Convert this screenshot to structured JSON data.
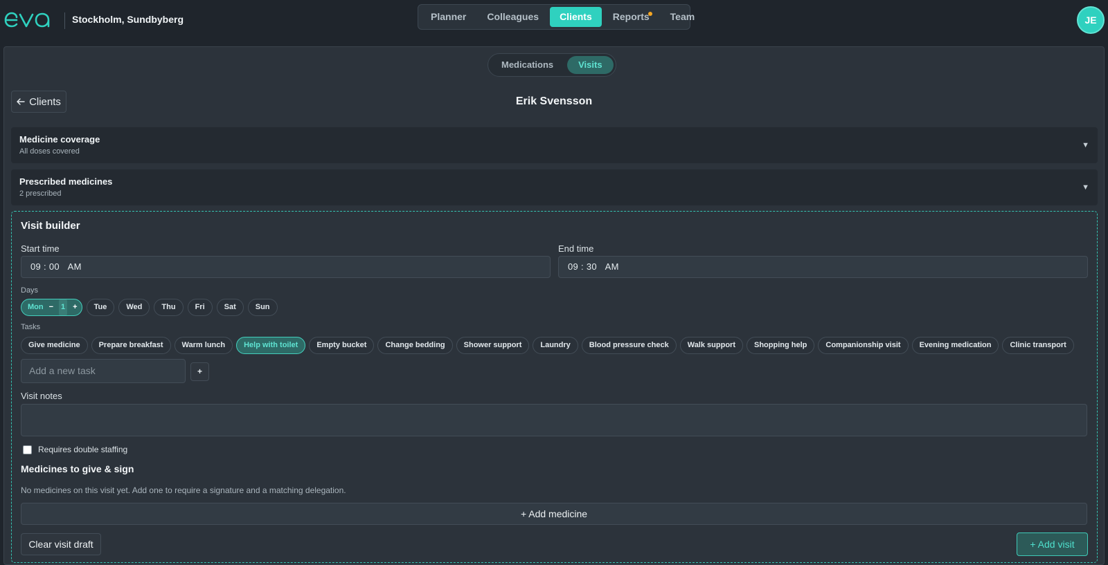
{
  "header": {
    "location": "Stockholm, Sundbyberg",
    "nav": [
      {
        "label": "Planner",
        "active": false
      },
      {
        "label": "Colleagues",
        "active": false
      },
      {
        "label": "Clients",
        "active": true
      },
      {
        "label": "Reports",
        "active": false,
        "notification": true
      },
      {
        "label": "Team",
        "active": false
      }
    ],
    "avatar_initials": "JE"
  },
  "tabs": [
    {
      "label": "Medications",
      "active": false
    },
    {
      "label": "Visits",
      "active": true
    }
  ],
  "back_button": {
    "icon": "arrow-left-icon",
    "label": "Clients"
  },
  "client_name": "Erik Svensson",
  "cards": [
    {
      "title": "Medicine coverage",
      "subtitle": "All doses covered",
      "icon": "caret-down-icon"
    },
    {
      "title": "Prescribed medicines",
      "subtitle": "2 prescribed",
      "icon": "caret-down-icon"
    }
  ],
  "builder": {
    "title": "Visit builder",
    "start_time_label": "Start time",
    "start_time": {
      "hour": "09",
      "minute": "00",
      "period": "AM"
    },
    "end_time_label": "End time",
    "end_time": {
      "hour": "09",
      "minute": "30",
      "period": "AM"
    },
    "days_label": "Days",
    "days": [
      {
        "label": "Mon",
        "active": true,
        "count": "1"
      },
      {
        "label": "Tue",
        "active": false
      },
      {
        "label": "Wed",
        "active": false
      },
      {
        "label": "Thu",
        "active": false
      },
      {
        "label": "Fri",
        "active": false
      },
      {
        "label": "Sat",
        "active": false
      },
      {
        "label": "Sun",
        "active": false
      }
    ],
    "tasks_label": "Tasks",
    "tasks": [
      {
        "label": "Give medicine",
        "active": false
      },
      {
        "label": "Prepare breakfast",
        "active": false
      },
      {
        "label": "Warm lunch",
        "active": false
      },
      {
        "label": "Help with toilet",
        "active": true
      },
      {
        "label": "Empty bucket",
        "active": false
      },
      {
        "label": "Change bedding",
        "active": false
      },
      {
        "label": "Shower support",
        "active": false
      },
      {
        "label": "Laundry",
        "active": false
      },
      {
        "label": "Blood pressure check",
        "active": false
      },
      {
        "label": "Walk support",
        "active": false
      },
      {
        "label": "Shopping help",
        "active": false
      },
      {
        "label": "Companionship visit",
        "active": false
      },
      {
        "label": "Evening medication",
        "active": false
      },
      {
        "label": "Clinic transport",
        "active": false
      }
    ],
    "new_task_placeholder": "Add a new task",
    "add_task_button": "+",
    "visit_notes_label": "Visit notes",
    "visit_notes_value": "",
    "double_staffing_label": "Requires double staffing",
    "double_staffing_checked": false,
    "medicines_title": "Medicines to give & sign",
    "medicines_empty": "No medicines on this visit yet. Add one to require a signature and a matching delegation.",
    "add_medicine_button": "+ Add medicine",
    "clear_button": "Clear visit draft",
    "add_visit_button": "+ Add visit"
  },
  "colors": {
    "accent": "#2fd1bf",
    "background": "#1f252c",
    "panel": "#2c333b",
    "notification": "#f5a623"
  }
}
